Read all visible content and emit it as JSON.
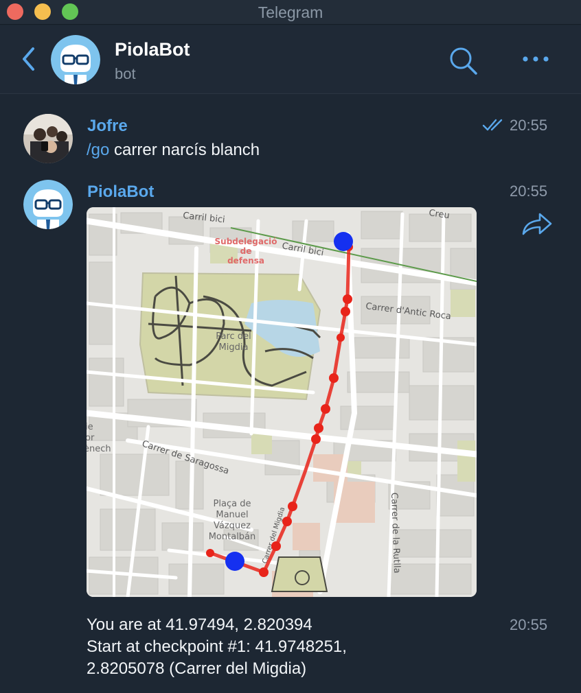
{
  "window": {
    "title": "Telegram"
  },
  "header": {
    "name": "PiolaBot",
    "subtitle": "bot"
  },
  "messages": [
    {
      "sender": "Jofre",
      "command": "/go",
      "text": " carrer narcís blanch",
      "time": "20:55",
      "status": "read"
    },
    {
      "sender": "PiolaBot",
      "time": "20:55",
      "attachment": "map-image"
    },
    {
      "lines": [
        "You are at 41.97494, 2.820394",
        "Start at checkpoint #1: 41.9748251,",
        "2.8205078 (Carrer del Migdia)"
      ],
      "time": "20:55"
    }
  ],
  "map": {
    "labels": {
      "carril_bici_1": "Carril bici",
      "carril_bici_2": "Carril bici",
      "creu": "Creu",
      "subdelegacio_1": "Subdelegació",
      "subdelegacio_2": "de",
      "subdelegacio_3": "defensa",
      "antic_roca": "Carrer d'Antic Roca",
      "parc_1": "Parc del",
      "parc_2": "Migdia",
      "saragossa": "Carrer de Saragossa",
      "placa_1": "Plaça de",
      "placa_2": "Manuel",
      "placa_3": "Vázquez",
      "placa_4": "Montalbán",
      "rutlla": "Carrer de la Rutlla",
      "edge_1": "ie",
      "edge_2": "or",
      "edge_3": "ènech",
      "migdia_street": "Carrer del Migdia"
    }
  },
  "colors": {
    "accent": "#5aa8ec",
    "background": "#1d2733",
    "route": "#e8241a",
    "marker": "#1530f0"
  }
}
